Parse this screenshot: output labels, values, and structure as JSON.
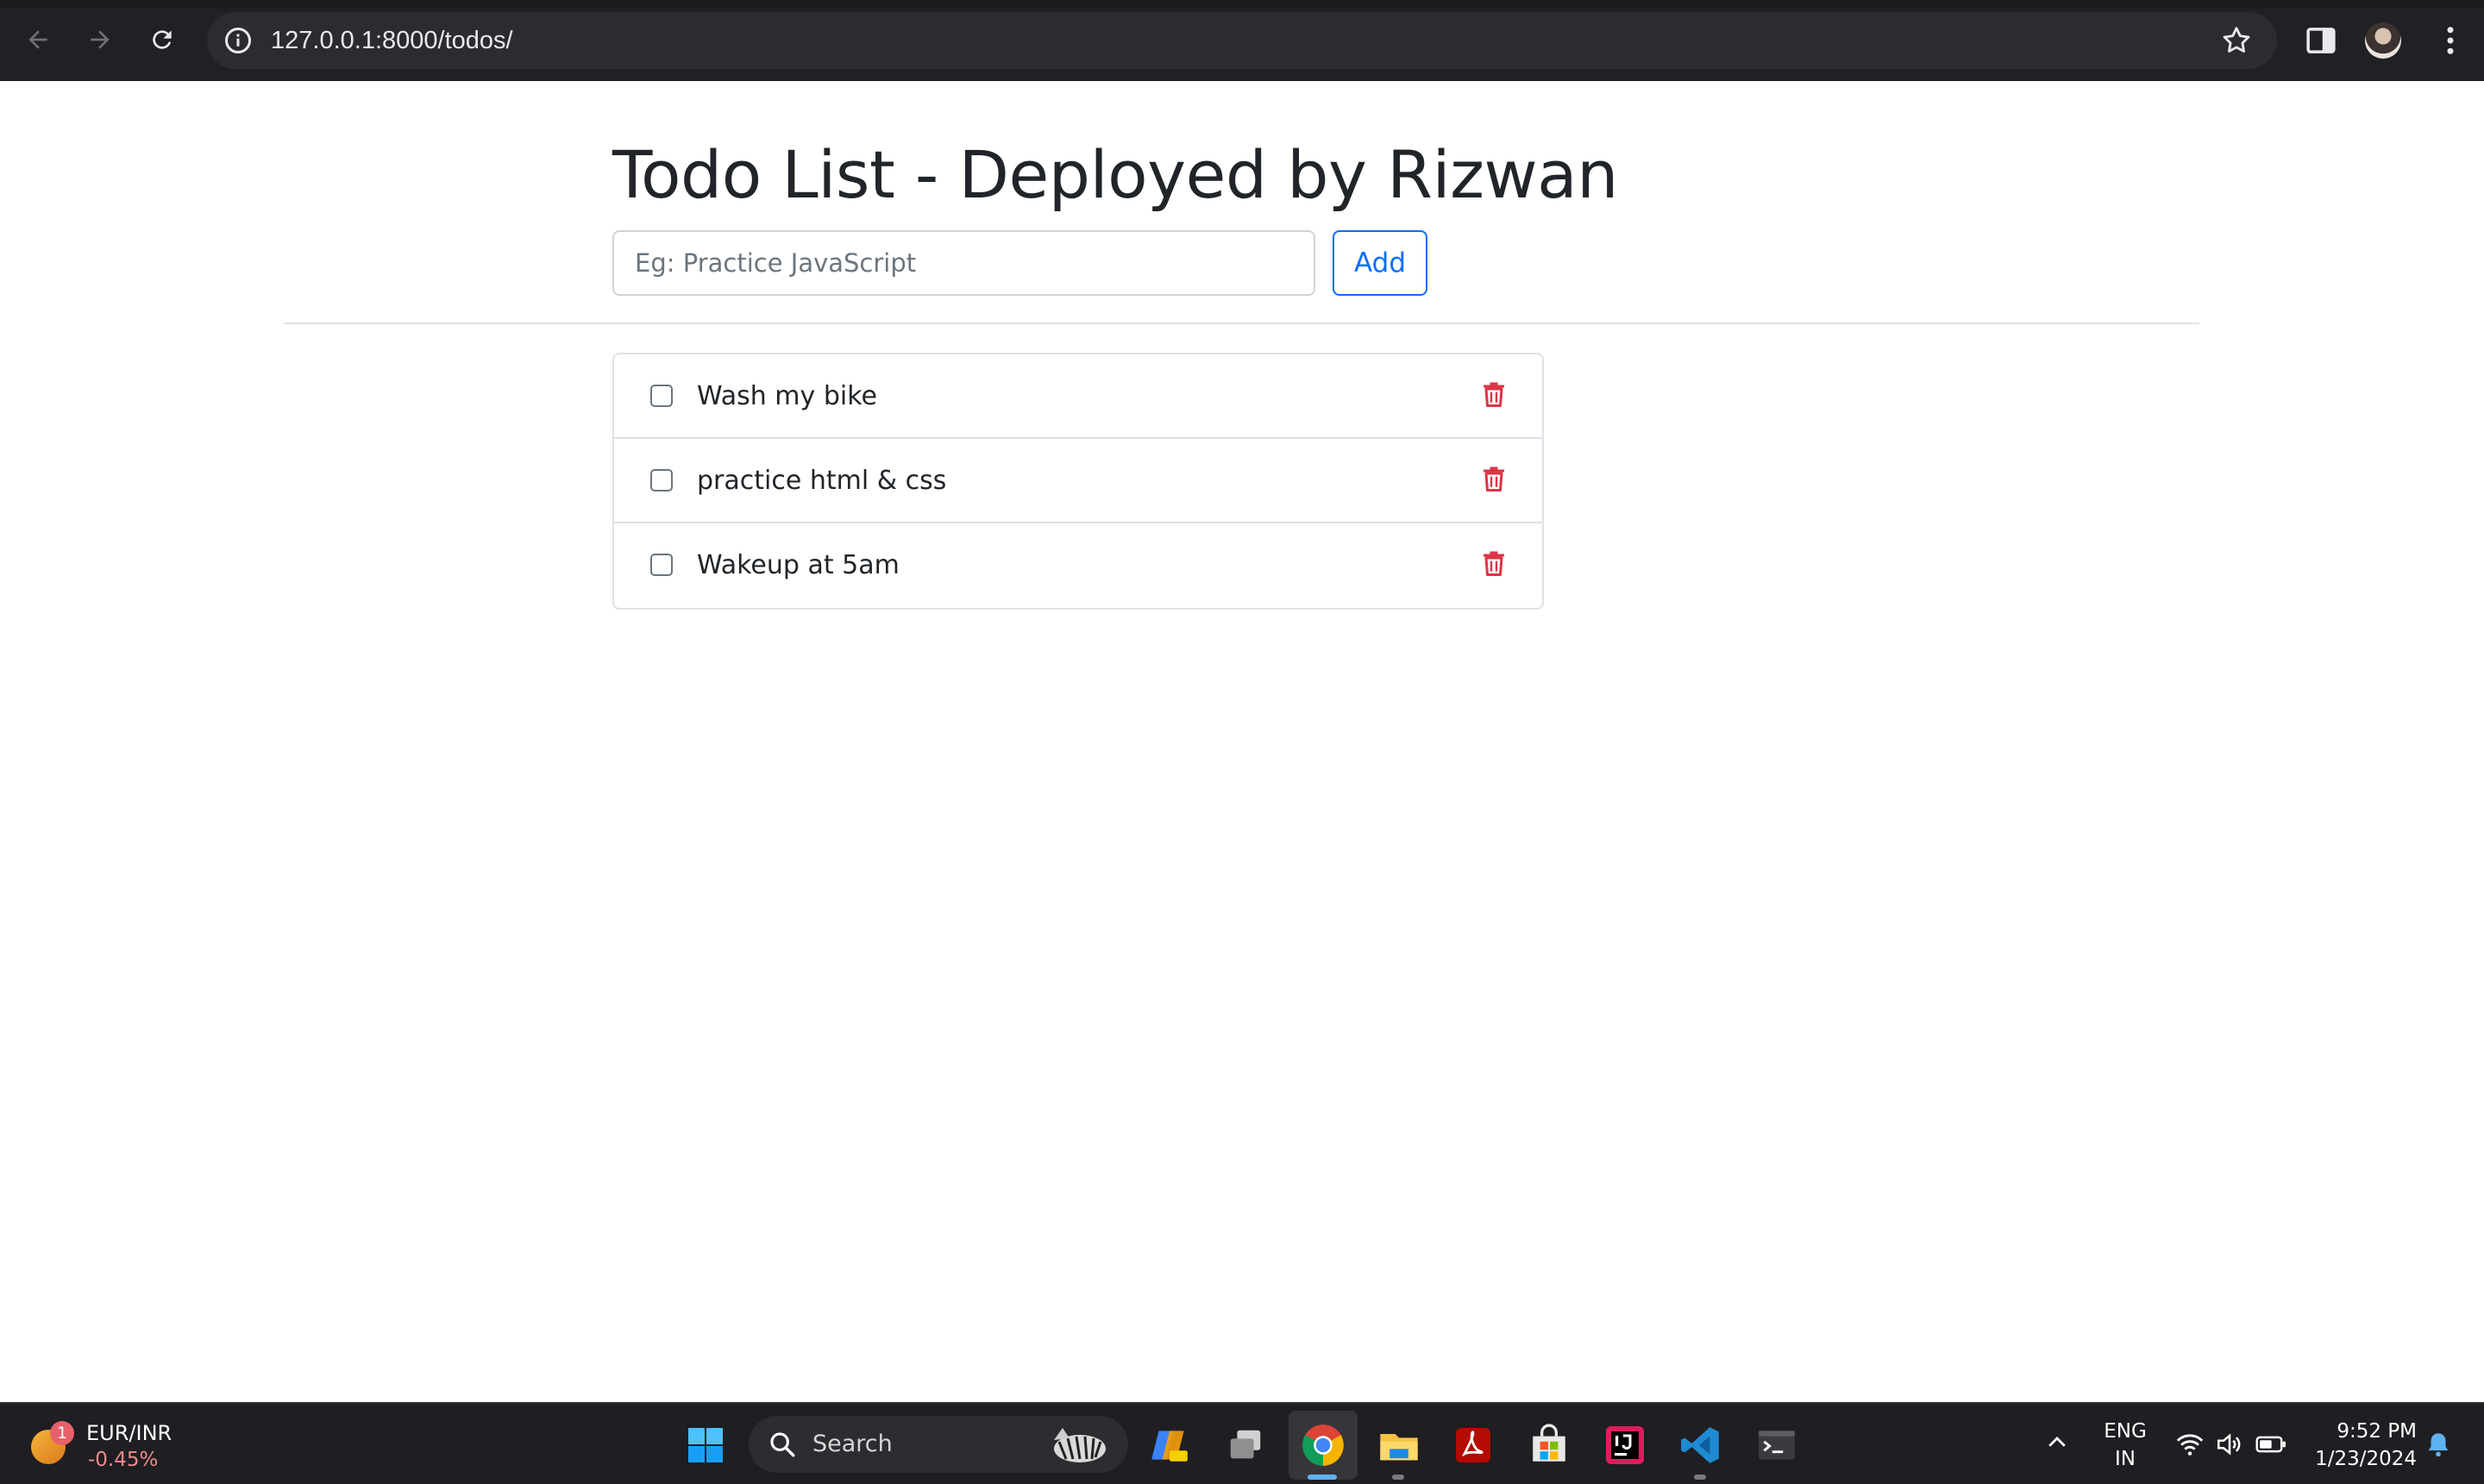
{
  "browser": {
    "url": "127.0.0.1:8000/todos/",
    "icons": [
      "back-arrow-icon",
      "forward-arrow-icon",
      "reload-icon",
      "site-info-icon",
      "bookmark-star-icon",
      "side-panel-icon",
      "kebab-menu-icon"
    ]
  },
  "page": {
    "title": "Todo List - Deployed by Rizwan",
    "input": {
      "value": "",
      "placeholder": "Eg: Practice JavaScript"
    },
    "add_label": "Add",
    "todos": [
      {
        "text": "Wash my bike",
        "checked": false
      },
      {
        "text": "practice html & css",
        "checked": false
      },
      {
        "text": "Wakeup at 5am",
        "checked": false
      }
    ],
    "colors": {
      "accent": "#0d6efd",
      "danger": "#dc3545",
      "text": "#212529"
    }
  },
  "taskbar": {
    "widget": {
      "badge": "1",
      "name": "EUR/INR",
      "change": "-0.45%"
    },
    "search_label": "Search",
    "lang_line1": "ENG",
    "lang_line2": "IN",
    "time": "9:52 PM",
    "date": "1/23/2024",
    "apps": [
      "windows-start-icon",
      "copilot-icon",
      "task-view-icon",
      "chrome-icon",
      "file-explorer-icon",
      "acrobat-icon",
      "ms-store-icon",
      "intellij-icon",
      "vscode-icon",
      "terminal-icon"
    ]
  }
}
